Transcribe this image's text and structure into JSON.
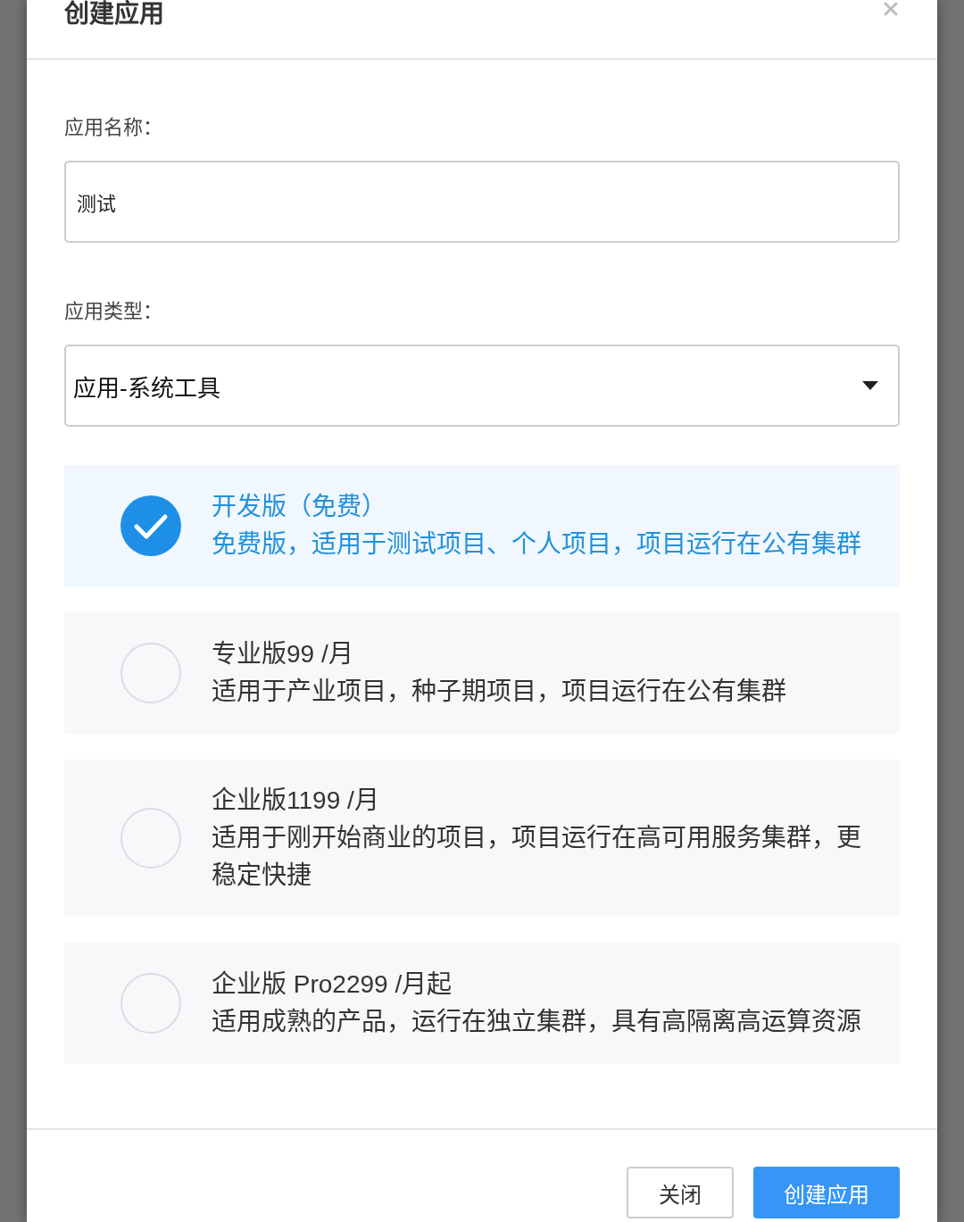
{
  "dialog": {
    "title": "创建应用"
  },
  "form": {
    "name_field": {
      "label": "应用名称：",
      "value": "测试"
    },
    "type_field": {
      "label": "应用类型：",
      "value": "应用-系统工具"
    }
  },
  "plans": [
    {
      "title": "开发版（免费）",
      "description": "免费版，适用于测试项目、个人项目，项目运行在公有集群",
      "selected": true
    },
    {
      "title": "专业版99 /月",
      "description": "适用于产业项目，种子期项目，项目运行在公有集群",
      "selected": false
    },
    {
      "title": "企业版1199 /月",
      "description": "适用于刚开始商业的项目，项目运行在高可用服务集群，更稳定快捷",
      "selected": false
    },
    {
      "title": "企业版 Pro2299 /月起",
      "description": "适用成熟的产品，运行在独立集群，具有高隔离高运算资源",
      "selected": false
    }
  ],
  "buttons": [
    {
      "label": "关闭",
      "kind": "secondary"
    },
    {
      "label": "创建应用",
      "kind": "primary"
    }
  ]
}
